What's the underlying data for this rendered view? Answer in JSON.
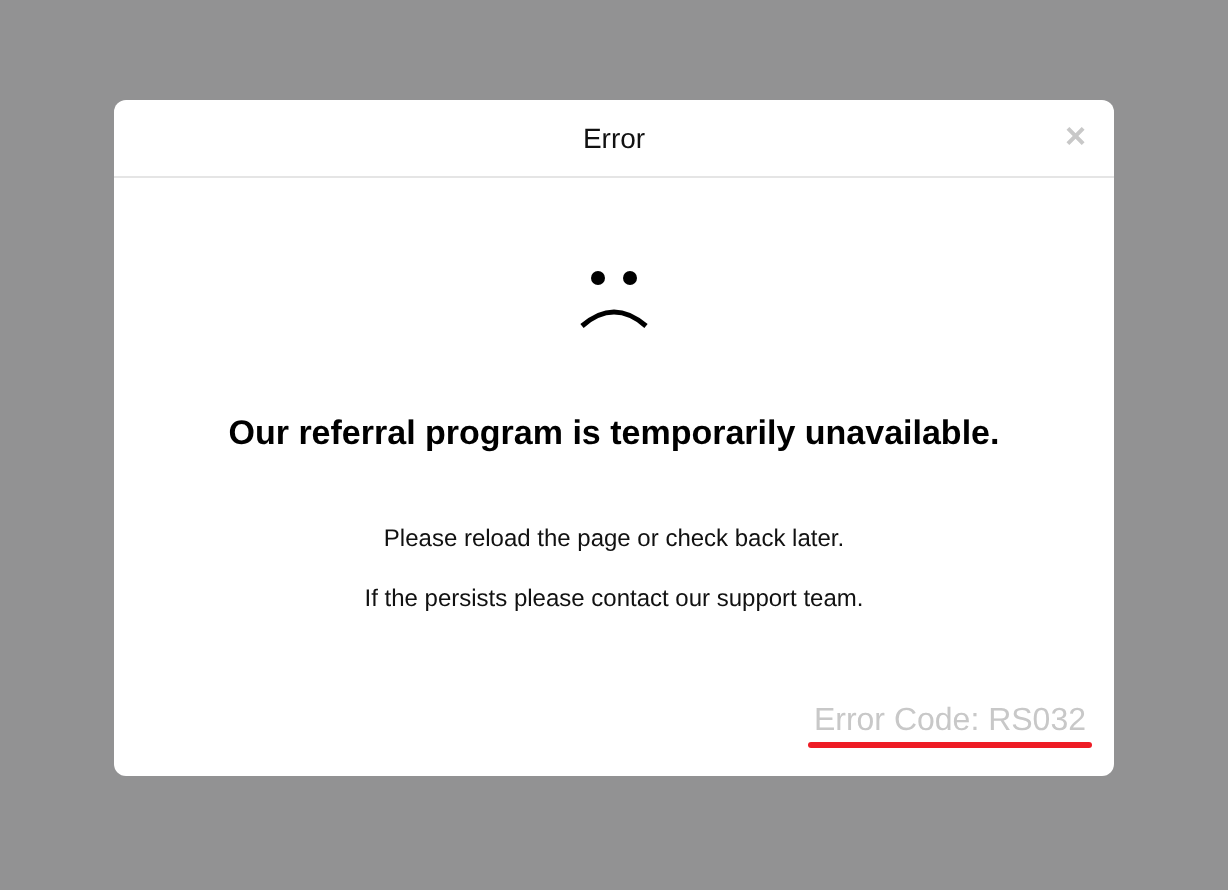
{
  "dialog": {
    "title": "Error",
    "close": "×",
    "heading": "Our referral program is temporarily unavailable.",
    "messages": [
      "Please reload the page or check back later.",
      "If the persists please contact our support team."
    ],
    "error_code": "Error Code: RS032",
    "error_code_underlined": true
  }
}
